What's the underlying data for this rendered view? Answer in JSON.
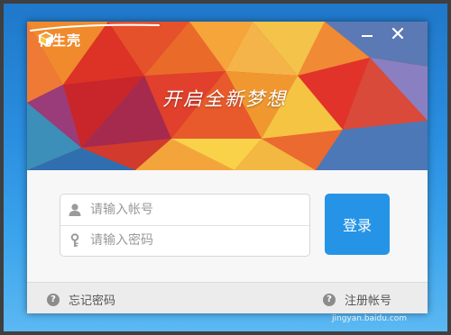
{
  "app": {
    "name": "花生壳",
    "slogan": "开启全新梦想"
  },
  "window_controls": {
    "minimize_glyph": "—",
    "close_glyph": "✕"
  },
  "login_form": {
    "username_placeholder": "请输入帐号",
    "password_placeholder": "请输入密码",
    "username_value": "",
    "password_value": "",
    "login_label": "登录"
  },
  "footer": {
    "forgot_password": "忘记密码",
    "register_account": "注册帐号"
  },
  "icons": {
    "logo": "peanut-shell-logo-icon",
    "user": "user-icon",
    "password": "key-icon",
    "help": "question-circle-icon"
  },
  "colors": {
    "accent": "#2694e6",
    "banner_red": "#e7452a",
    "banner_yellow": "#f7c842",
    "desktop_blue": "#2a8ee0"
  },
  "watermark": "jingyan.baidu.com"
}
